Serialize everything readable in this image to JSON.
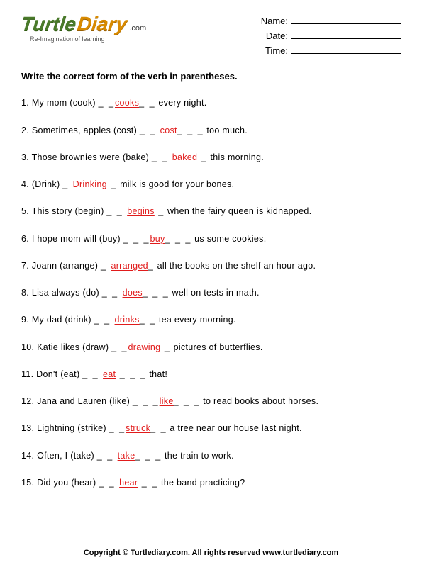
{
  "logo": {
    "part1": "Turtle",
    "part2": "Diary",
    "suffix": ".com",
    "tagline": "Re-Imagination of learning"
  },
  "fields": {
    "name": "Name:",
    "date": "Date:",
    "time": "Time:"
  },
  "instruction": "Write the correct form of the verb in parentheses.",
  "questions": [
    {
      "n": "1.",
      "pre": "My mom (cook) ",
      "d1": "_ _",
      "ans": "cooks",
      "d2": "_ _",
      "post": " every night."
    },
    {
      "n": "2.",
      "pre": "Sometimes, apples (cost) ",
      "d1": "_ _ ",
      "ans": "cost",
      "d2": "_ _ _",
      "post": " too much."
    },
    {
      "n": "3.",
      "pre": "Those brownies were (bake) ",
      "d1": "_ _ ",
      "ans": "baked",
      "d2": " _",
      "post": " this morning."
    },
    {
      "n": "4.",
      "pre": "(Drink) ",
      "d1": "_ ",
      "ans": "Drinking",
      "d2": " _",
      "post": " milk is good for your bones."
    },
    {
      "n": "5.",
      "pre": "This story (begin) ",
      "d1": "_ _ ",
      "ans": "begins",
      "d2": " _",
      "post": " when the fairy queen is kidnapped."
    },
    {
      "n": "6.",
      "pre": "I hope mom will (buy) ",
      "d1": "_ _ _",
      "ans": "buy",
      "d2": "_ _ _",
      "post": " us some cookies."
    },
    {
      "n": "7.",
      "pre": "Joann (arrange) ",
      "d1": "_ ",
      "ans": "arranged",
      "d2": "_",
      "post": " all the books on the shelf an hour ago."
    },
    {
      "n": "8.",
      "pre": "Lisa always (do) ",
      "d1": "_ _ ",
      "ans": "does",
      "d2": "_ _ _",
      "post": " well on tests in math."
    },
    {
      "n": "9.",
      "pre": "My dad (drink) ",
      "d1": "_ _ ",
      "ans": "drinks",
      "d2": "_ _",
      "post": " tea every morning."
    },
    {
      "n": "10.",
      "pre": "Katie likes (draw) ",
      "d1": "_ _",
      "ans": "drawing",
      "d2": " _",
      "post": " pictures of butterflies."
    },
    {
      "n": "11.",
      "pre": "Don't (eat) ",
      "d1": "_ _ ",
      "ans": "eat",
      "d2": " _ _ _",
      "post": " that!"
    },
    {
      "n": "12.",
      "pre": "Jana and Lauren (like) ",
      "d1": "_ _ _",
      "ans": "like",
      "d2": "_ _ _",
      "post": " to read books about horses."
    },
    {
      "n": "13.",
      "pre": "Lightning (strike) ",
      "d1": "_ _",
      "ans": "struck",
      "d2": "_ _",
      "post": " a tree near our house last night."
    },
    {
      "n": "14.",
      "pre": "Often, I (take) ",
      "d1": "_ _ ",
      "ans": "take",
      "d2": "_ _ _",
      "post": " the train to work."
    },
    {
      "n": "15.",
      "pre": "Did you (hear) ",
      "d1": "_ _ ",
      "ans": "hear",
      "d2": " _ _",
      "post": " the band practicing?"
    }
  ],
  "footer": {
    "copyright": "Copyright © Turtlediary.com. All rights reserved  ",
    "url": "www.turtlediary.com"
  }
}
